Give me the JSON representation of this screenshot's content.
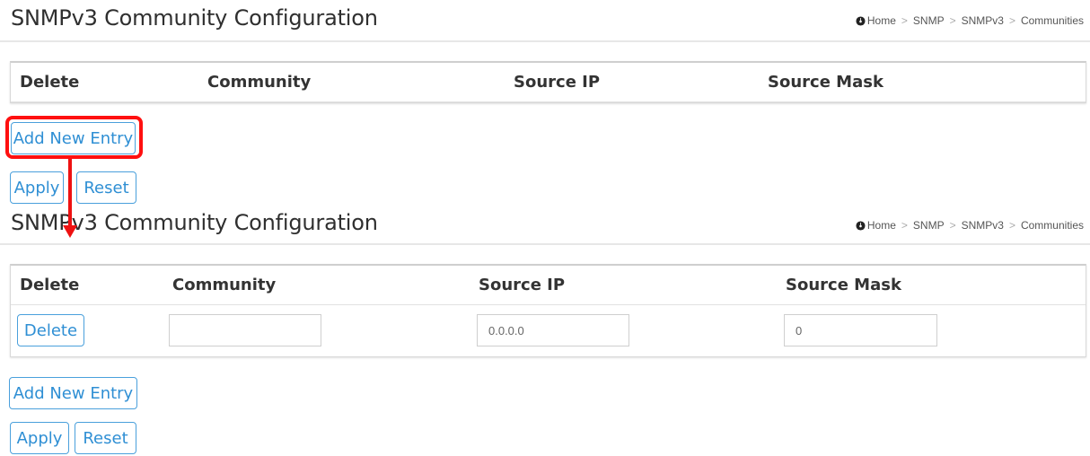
{
  "page": {
    "title": "SNMPv3 Community Configuration",
    "breadcrumb": [
      "Home",
      "SNMP",
      "SNMPv3",
      "Communities"
    ]
  },
  "table": {
    "columns": [
      "Delete",
      "Community",
      "Source IP",
      "Source Mask"
    ]
  },
  "buttons": {
    "add_new_entry": "Add New Entry",
    "apply": "Apply",
    "reset": "Reset",
    "delete": "Delete"
  },
  "entry_row": {
    "community_value": "",
    "source_ip_value": "0.0.0.0",
    "source_mask_value": "0"
  },
  "colors": {
    "accent": "#2f8fd4",
    "highlight": "#ff1010"
  }
}
